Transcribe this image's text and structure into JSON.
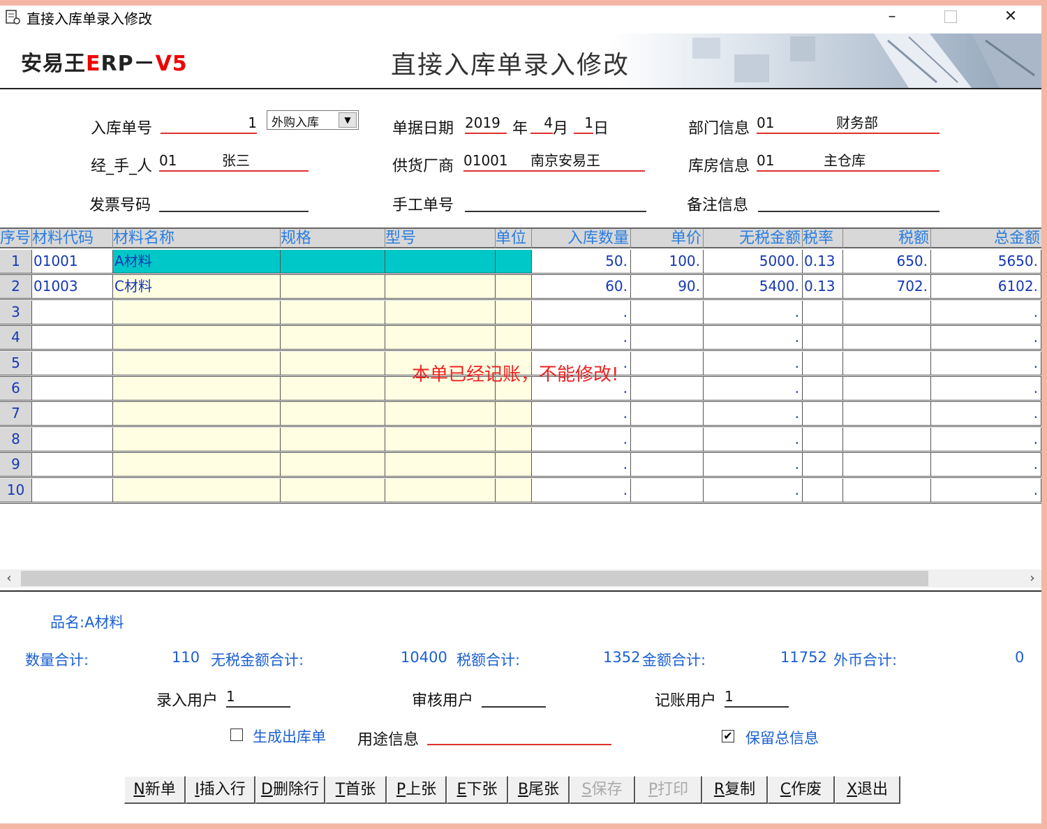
{
  "window": {
    "title": "直接入库单录入修改"
  },
  "banner": {
    "brand_black1": "安易王",
    "brand_red1": "E",
    "brand_black2": "RP－",
    "brand_red2": "V5",
    "form_title": "直接入库单录入修改"
  },
  "header": {
    "receipt_no_label": "入库单号",
    "receipt_no": "1",
    "type_value": "外购入库",
    "date_label": "单据日期",
    "year": "2019",
    "year_unit": "年",
    "month": "4",
    "month_unit": "月",
    "day": "1",
    "day_unit": "日",
    "dept_label": "部门信息",
    "dept_code": "01",
    "dept_name": "财务部",
    "handler_label": "经_手_人",
    "handler_code": "01",
    "handler_name": "张三",
    "supplier_label": "供货厂商",
    "supplier_code": "01001",
    "supplier_name": "南京安易王",
    "warehouse_label": "库房信息",
    "warehouse_code": "01",
    "warehouse_name": "主仓库",
    "invoice_label": "发票号码",
    "invoice_value": "",
    "manual_no_label": "手工单号",
    "manual_no_value": "",
    "remark_label": "备注信息",
    "remark_value": ""
  },
  "grid": {
    "columns": [
      "序号",
      "材料代码",
      "材料名称",
      "规格",
      "型号",
      "单位",
      "入库数量",
      "单价",
      "无税金额",
      "税率",
      "税额",
      "总金额"
    ],
    "rows": [
      {
        "no": "1",
        "code": "01001",
        "name": "A材料",
        "spec": "",
        "model": "",
        "unit": "",
        "qty": "50.",
        "price": "100.",
        "net": "5000.",
        "rate": "0.13",
        "tax": "650.",
        "total": "5650."
      },
      {
        "no": "2",
        "code": "01003",
        "name": "C材料",
        "spec": "",
        "model": "",
        "unit": "",
        "qty": "60.",
        "price": "90.",
        "net": "5400.",
        "rate": "0.13",
        "tax": "702.",
        "total": "6102."
      },
      {
        "no": "3",
        "code": "",
        "name": "",
        "spec": "",
        "model": "",
        "unit": "",
        "qty": ".",
        "price": "",
        "net": ".",
        "rate": "",
        "tax": "",
        "total": "."
      },
      {
        "no": "4",
        "code": "",
        "name": "",
        "spec": "",
        "model": "",
        "unit": "",
        "qty": ".",
        "price": "",
        "net": ".",
        "rate": "",
        "tax": "",
        "total": "."
      },
      {
        "no": "5",
        "code": "",
        "name": "",
        "spec": "",
        "model": "",
        "unit": "",
        "qty": ".",
        "price": "",
        "net": ".",
        "rate": "",
        "tax": "",
        "total": "."
      },
      {
        "no": "6",
        "code": "",
        "name": "",
        "spec": "",
        "model": "",
        "unit": "",
        "qty": ".",
        "price": "",
        "net": ".",
        "rate": "",
        "tax": "",
        "total": "."
      },
      {
        "no": "7",
        "code": "",
        "name": "",
        "spec": "",
        "model": "",
        "unit": "",
        "qty": ".",
        "price": "",
        "net": ".",
        "rate": "",
        "tax": "",
        "total": "."
      },
      {
        "no": "8",
        "code": "",
        "name": "",
        "spec": "",
        "model": "",
        "unit": "",
        "qty": ".",
        "price": "",
        "net": ".",
        "rate": "",
        "tax": "",
        "total": "."
      },
      {
        "no": "9",
        "code": "",
        "name": "",
        "spec": "",
        "model": "",
        "unit": "",
        "qty": ".",
        "price": "",
        "net": ".",
        "rate": "",
        "tax": "",
        "total": "."
      },
      {
        "no": "10",
        "code": "",
        "name": "",
        "spec": "",
        "model": "",
        "unit": "",
        "qty": ".",
        "price": "",
        "net": ".",
        "rate": "",
        "tax": "",
        "total": "."
      }
    ],
    "notice": "本单已经记账，不能修改!"
  },
  "summary": {
    "item_label": "品名:",
    "item_value": "A材料",
    "qty_label": "数量合计:",
    "qty_total": "110",
    "net_label": "无税金额合计:",
    "net_total": "10400",
    "tax_label": "税额合计:",
    "tax_total": "1352",
    "amount_label": "金额合计:",
    "amount_total": "11752",
    "fx_label": "外币合计:",
    "fx_total": "0",
    "entry_user_label": "录入用户",
    "entry_user": "1",
    "audit_user_label": "审核用户",
    "audit_user": "",
    "post_user_label": "记账用户",
    "post_user": "1",
    "gen_out_label": "生成出库单",
    "gen_out_checked": false,
    "purpose_label": "用途信息",
    "purpose_value": "",
    "keep_total_label": "保留总信息",
    "keep_total_checked": true
  },
  "buttons": [
    {
      "key": "N",
      "label": "新单",
      "enabled": true
    },
    {
      "key": "I",
      "label": "插入行",
      "enabled": true
    },
    {
      "key": "D",
      "label": "删除行",
      "enabled": true
    },
    {
      "key": "T",
      "label": "首张",
      "enabled": true
    },
    {
      "key": "P",
      "label": "上张",
      "enabled": true
    },
    {
      "key": "E",
      "label": "下张",
      "enabled": true
    },
    {
      "key": "B",
      "label": "尾张",
      "enabled": true
    },
    {
      "key": "S",
      "label": "保存",
      "enabled": false
    },
    {
      "key": "P",
      "label": "打印",
      "enabled": false
    },
    {
      "key": "R",
      "label": "复制",
      "enabled": true
    },
    {
      "key": "C",
      "label": "作废",
      "enabled": true
    },
    {
      "key": "X",
      "label": "退出",
      "enabled": true
    }
  ],
  "icons": {
    "app": "scroll-app-icon",
    "minimize": "minimize-icon",
    "maximize": "maximize-icon",
    "close": "close-icon",
    "dropdown": "chevron-down-icon"
  }
}
